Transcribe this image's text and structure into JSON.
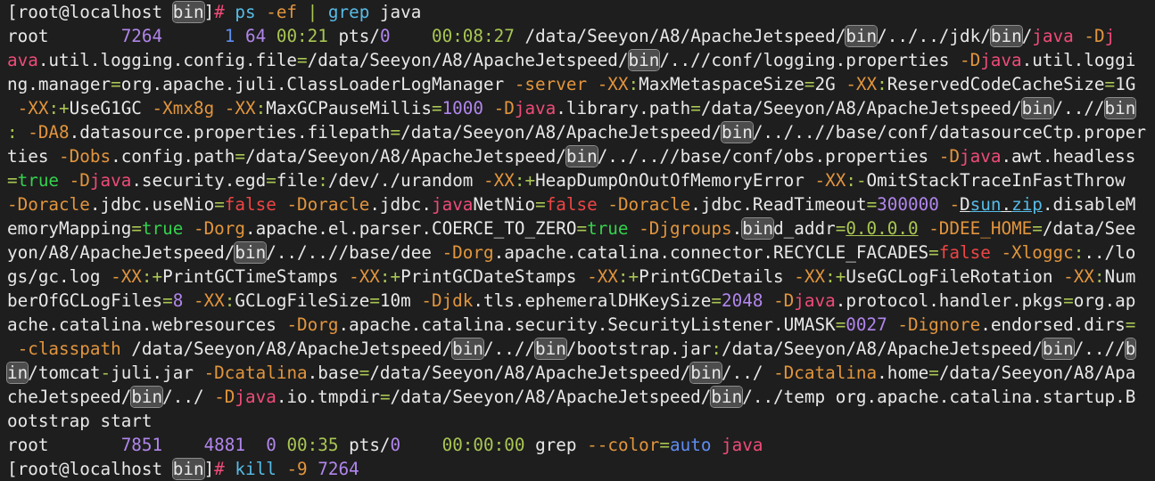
{
  "terminal": {
    "title": "root shell in /data/Seeyon/A8/ApacheJetspeed/bin",
    "search_highlight_term": "bin",
    "grep_match_term": "java",
    "palette": {
      "bg": "#1e1e1e",
      "fg": "#e8e8e8",
      "pink": "#ee4b78",
      "orange": "#e2953d",
      "green": "#a9c653",
      "bgreen": "#35d14e",
      "red": "#ef4545",
      "purple": "#b186ec",
      "blue": "#5f8df2",
      "cyan": "#57bbe6",
      "hlbg": "#4d4d4d",
      "hlborder": "#8d8d8d"
    },
    "prompt": {
      "user_host": "root@localhost",
      "cwd": "bin",
      "symbol": "#"
    },
    "commands": [
      "ps -ef | grep java",
      "kill -9 7264"
    ],
    "process_table": {
      "rows": [
        {
          "uid": "root",
          "pid": "7264",
          "ppid": "1",
          "c": "64",
          "stime": "00:21",
          "tty": "pts/0",
          "time": "00:08:27",
          "cmd_start": "/data/Seeyon/A8/ApacheJetspeed/bin/../../jdk/bin/java"
        },
        {
          "uid": "root",
          "pid": "7851",
          "ppid": "4881",
          "c": "0",
          "stime": "00:35",
          "tty": "pts/0",
          "time": "00:00:00",
          "cmd_start": "grep --color=auto java"
        }
      ]
    },
    "lines": [
      [
        {
          "t": "[root@localhost "
        },
        {
          "t": "bin",
          "h": true
        },
        {
          "t": "]"
        },
        {
          "t": "#",
          "c": "pink"
        },
        {
          "t": " "
        },
        {
          "t": "ps",
          "c": "cyan"
        },
        {
          "t": " "
        },
        {
          "t": "-ef",
          "c": "orange"
        },
        {
          "t": " "
        },
        {
          "t": "|",
          "c": "green"
        },
        {
          "t": " "
        },
        {
          "t": "grep",
          "c": "cyan"
        },
        {
          "t": " java"
        }
      ],
      [
        {
          "t": "root       "
        },
        {
          "t": "7264",
          "c": "purple"
        },
        {
          "t": "      "
        },
        {
          "t": "1",
          "c": "blue"
        },
        {
          "t": " "
        },
        {
          "t": "64",
          "c": "purple"
        },
        {
          "t": " "
        },
        {
          "t": "00:21",
          "c": "green"
        },
        {
          "t": " pts/"
        },
        {
          "t": "0",
          "c": "purple"
        },
        {
          "t": "    "
        },
        {
          "t": "00:08:27",
          "c": "green"
        },
        {
          "t": " /data/Seeyon/A8/ApacheJetspeed/"
        },
        {
          "t": "bin",
          "h": true
        },
        {
          "t": "/../../jdk/"
        },
        {
          "t": "bin",
          "h": true
        },
        {
          "t": "/"
        },
        {
          "t": "java",
          "c": "pink"
        },
        {
          "t": " "
        },
        {
          "t": "-D",
          "c": "orange"
        },
        {
          "t": "j",
          "c": "pink"
        }
      ],
      [
        {
          "t": "ava",
          "c": "pink"
        },
        {
          "t": ".util.logging.config.file"
        },
        {
          "t": "=",
          "c": "green"
        },
        {
          "t": "/data/Seeyon/A8/ApacheJetspeed/"
        },
        {
          "t": "bin",
          "h": true
        },
        {
          "t": "/..//conf/logging.properties "
        },
        {
          "t": "-D",
          "c": "orange"
        },
        {
          "t": "java",
          "c": "pink"
        },
        {
          "t": ".util.loggi"
        }
      ],
      [
        {
          "t": "ng.manager"
        },
        {
          "t": "=",
          "c": "green"
        },
        {
          "t": "org.apache.juli.ClassLoaderLogManager "
        },
        {
          "t": "-server",
          "c": "orange"
        },
        {
          "t": " "
        },
        {
          "t": "-XX",
          "c": "orange"
        },
        {
          "t": ":",
          "c": "green"
        },
        {
          "t": "MaxMetaspaceSize"
        },
        {
          "t": "=",
          "c": "green"
        },
        {
          "t": "2G "
        },
        {
          "t": "-XX",
          "c": "orange"
        },
        {
          "t": ":",
          "c": "green"
        },
        {
          "t": "ReservedCodeCacheSize"
        },
        {
          "t": "=",
          "c": "green"
        },
        {
          "t": "1G"
        }
      ],
      [
        {
          "t": " "
        },
        {
          "t": "-XX",
          "c": "orange"
        },
        {
          "t": ":",
          "c": "green"
        },
        {
          "t": "+",
          "c": "green"
        },
        {
          "t": "UseG1GC "
        },
        {
          "t": "-Xmx8g",
          "c": "orange"
        },
        {
          "t": " "
        },
        {
          "t": "-XX",
          "c": "orange"
        },
        {
          "t": ":",
          "c": "green"
        },
        {
          "t": "MaxGCPauseMillis"
        },
        {
          "t": "=",
          "c": "green"
        },
        {
          "t": "1000",
          "c": "purple"
        },
        {
          "t": " "
        },
        {
          "t": "-D",
          "c": "orange"
        },
        {
          "t": "java",
          "c": "pink"
        },
        {
          "t": ".library.path"
        },
        {
          "t": "=",
          "c": "green"
        },
        {
          "t": "/data/Seeyon/A8/ApacheJetspeed/"
        },
        {
          "t": "bin",
          "h": true
        },
        {
          "t": "/..//"
        },
        {
          "t": "bin",
          "h": true
        }
      ],
      [
        {
          "t": ":",
          "c": "green"
        },
        {
          "t": " "
        },
        {
          "t": "-DA8",
          "c": "orange"
        },
        {
          "t": ".datasource.properties.filepath"
        },
        {
          "t": "=",
          "c": "green"
        },
        {
          "t": "/data/Seeyon/A8/ApacheJetspeed/"
        },
        {
          "t": "bin",
          "h": true
        },
        {
          "t": "/../..//base/conf/datasourceCtp.proper"
        }
      ],
      [
        {
          "t": "ties "
        },
        {
          "t": "-Dobs",
          "c": "orange"
        },
        {
          "t": ".config.path"
        },
        {
          "t": "=",
          "c": "green"
        },
        {
          "t": "/data/Seeyon/A8/ApacheJetspeed/"
        },
        {
          "t": "bin",
          "h": true
        },
        {
          "t": "/../..//base/conf/obs.properties "
        },
        {
          "t": "-D",
          "c": "orange"
        },
        {
          "t": "java",
          "c": "pink"
        },
        {
          "t": ".awt.headless"
        }
      ],
      [
        {
          "t": "=",
          "c": "green"
        },
        {
          "t": "true",
          "c": "bgreen"
        },
        {
          "t": " "
        },
        {
          "t": "-D",
          "c": "orange"
        },
        {
          "t": "java",
          "c": "pink"
        },
        {
          "t": ".security.egd"
        },
        {
          "t": "=",
          "c": "green"
        },
        {
          "t": "file"
        },
        {
          "t": ":",
          "c": "green"
        },
        {
          "t": "/dev/./urandom "
        },
        {
          "t": "-XX",
          "c": "orange"
        },
        {
          "t": ":",
          "c": "green"
        },
        {
          "t": "+",
          "c": "green"
        },
        {
          "t": "HeapDumpOnOutOfMemoryError "
        },
        {
          "t": "-XX",
          "c": "orange"
        },
        {
          "t": ":",
          "c": "green"
        },
        {
          "t": "-",
          "c": "green"
        },
        {
          "t": "OmitStackTraceInFastThrow"
        }
      ],
      [
        {
          "t": "-Doracle",
          "c": "orange"
        },
        {
          "t": ".jdbc.useNio"
        },
        {
          "t": "=",
          "c": "green"
        },
        {
          "t": "false",
          "c": "red"
        },
        {
          "t": " "
        },
        {
          "t": "-Doracle",
          "c": "orange"
        },
        {
          "t": ".jdbc."
        },
        {
          "t": "java",
          "c": "pink"
        },
        {
          "t": "NetNio"
        },
        {
          "t": "=",
          "c": "green"
        },
        {
          "t": "false",
          "c": "red"
        },
        {
          "t": " "
        },
        {
          "t": "-Doracle",
          "c": "orange"
        },
        {
          "t": ".jdbc.ReadTimeout"
        },
        {
          "t": "=",
          "c": "green"
        },
        {
          "t": "300000",
          "c": "purple"
        },
        {
          "t": " "
        },
        {
          "t": "-",
          "c": "orange"
        },
        {
          "t": "D",
          "u": true
        },
        {
          "t": "sun",
          "c": "cyan",
          "u": true
        },
        {
          "t": ".",
          "u": true
        },
        {
          "t": "zip",
          "c": "cyan",
          "u": true
        },
        {
          "t": ".disableM"
        }
      ],
      [
        {
          "t": "emoryMapping"
        },
        {
          "t": "=",
          "c": "green"
        },
        {
          "t": "true",
          "c": "bgreen"
        },
        {
          "t": " "
        },
        {
          "t": "-Dorg",
          "c": "orange"
        },
        {
          "t": ".apache.el.parser.COERCE_TO_ZERO"
        },
        {
          "t": "=",
          "c": "green"
        },
        {
          "t": "true",
          "c": "bgreen"
        },
        {
          "t": " "
        },
        {
          "t": "-Djgroups",
          "c": "orange"
        },
        {
          "t": "."
        },
        {
          "t": "bin",
          "h": true
        },
        {
          "t": "d_addr"
        },
        {
          "t": "=",
          "c": "green"
        },
        {
          "t": "0.0.0.0",
          "c": "green",
          "u": true
        },
        {
          "t": " "
        },
        {
          "t": "-DDEE_HOME",
          "c": "orange"
        },
        {
          "t": "=",
          "c": "green"
        },
        {
          "t": "/data/See"
        }
      ],
      [
        {
          "t": "yon/A8/ApacheJetspeed/"
        },
        {
          "t": "bin",
          "h": true
        },
        {
          "t": "/../..//base/dee "
        },
        {
          "t": "-Dorg",
          "c": "orange"
        },
        {
          "t": ".apache.catalina.connector.RECYCLE_FACADES"
        },
        {
          "t": "=",
          "c": "green"
        },
        {
          "t": "false",
          "c": "red"
        },
        {
          "t": " "
        },
        {
          "t": "-Xloggc",
          "c": "orange"
        },
        {
          "t": ":",
          "c": "green"
        },
        {
          "t": "../lo"
        }
      ],
      [
        {
          "t": "gs/gc.log "
        },
        {
          "t": "-XX",
          "c": "orange"
        },
        {
          "t": ":",
          "c": "green"
        },
        {
          "t": "+",
          "c": "green"
        },
        {
          "t": "PrintGCTimeStamps "
        },
        {
          "t": "-XX",
          "c": "orange"
        },
        {
          "t": ":",
          "c": "green"
        },
        {
          "t": "+",
          "c": "green"
        },
        {
          "t": "PrintGCDateStamps "
        },
        {
          "t": "-XX",
          "c": "orange"
        },
        {
          "t": ":",
          "c": "green"
        },
        {
          "t": "+",
          "c": "green"
        },
        {
          "t": "PrintGCDetails "
        },
        {
          "t": "-XX",
          "c": "orange"
        },
        {
          "t": ":",
          "c": "green"
        },
        {
          "t": "+",
          "c": "green"
        },
        {
          "t": "UseGCLogFileRotation "
        },
        {
          "t": "-XX",
          "c": "orange"
        },
        {
          "t": ":",
          "c": "green"
        },
        {
          "t": "Num"
        }
      ],
      [
        {
          "t": "berOfGCLogFiles"
        },
        {
          "t": "=",
          "c": "green"
        },
        {
          "t": "8",
          "c": "purple"
        },
        {
          "t": " "
        },
        {
          "t": "-XX",
          "c": "orange"
        },
        {
          "t": ":",
          "c": "green"
        },
        {
          "t": "GCLogFileSize"
        },
        {
          "t": "=",
          "c": "green"
        },
        {
          "t": "10m "
        },
        {
          "t": "-Djdk",
          "c": "orange"
        },
        {
          "t": ".tls.ephemeralDHKeySize"
        },
        {
          "t": "=",
          "c": "green"
        },
        {
          "t": "2048",
          "c": "purple"
        },
        {
          "t": " "
        },
        {
          "t": "-D",
          "c": "orange"
        },
        {
          "t": "java",
          "c": "pink"
        },
        {
          "t": ".protocol.handler.pkgs"
        },
        {
          "t": "=",
          "c": "green"
        },
        {
          "t": "org.ap"
        }
      ],
      [
        {
          "t": "ache.catalina.webresources "
        },
        {
          "t": "-Dorg",
          "c": "orange"
        },
        {
          "t": ".apache.catalina.security.SecurityListener.UMASK"
        },
        {
          "t": "=",
          "c": "green"
        },
        {
          "t": "0027",
          "c": "purple"
        },
        {
          "t": " "
        },
        {
          "t": "-Dignore",
          "c": "orange"
        },
        {
          "t": ".endorsed.dirs"
        },
        {
          "t": "=",
          "c": "green"
        }
      ],
      [
        {
          "t": " "
        },
        {
          "t": "-classpath",
          "c": "orange"
        },
        {
          "t": " /data/Seeyon/A8/ApacheJetspeed/"
        },
        {
          "t": "bin",
          "h": true
        },
        {
          "t": "/..//"
        },
        {
          "t": "bin",
          "h": true
        },
        {
          "t": "/bootstrap.jar"
        },
        {
          "t": ":",
          "c": "green"
        },
        {
          "t": "/data/Seeyon/A8/ApacheJetspeed/"
        },
        {
          "t": "bin",
          "h": true
        },
        {
          "t": "/..//"
        },
        {
          "t": "b",
          "h": true
        }
      ],
      [
        {
          "t": "in",
          "h": true
        },
        {
          "t": "/tomcat"
        },
        {
          "t": "-",
          "c": "green"
        },
        {
          "t": "juli.jar "
        },
        {
          "t": "-Dcatalina",
          "c": "orange"
        },
        {
          "t": ".base"
        },
        {
          "t": "=",
          "c": "green"
        },
        {
          "t": "/data/Seeyon/A8/ApacheJetspeed/"
        },
        {
          "t": "bin",
          "h": true
        },
        {
          "t": "/../ "
        },
        {
          "t": "-Dcatalina",
          "c": "orange"
        },
        {
          "t": ".home"
        },
        {
          "t": "=",
          "c": "green"
        },
        {
          "t": "/data/Seeyon/A8/Apa"
        }
      ],
      [
        {
          "t": "cheJetspeed/"
        },
        {
          "t": "bin",
          "h": true
        },
        {
          "t": "/../ "
        },
        {
          "t": "-D",
          "c": "orange"
        },
        {
          "t": "java",
          "c": "pink"
        },
        {
          "t": ".io.tmpdir"
        },
        {
          "t": "=",
          "c": "green"
        },
        {
          "t": "/data/Seeyon/A8/ApacheJetspeed/"
        },
        {
          "t": "bin",
          "h": true
        },
        {
          "t": "/../temp org.apache.catalina.startup.B"
        }
      ],
      [
        {
          "t": "ootstrap start"
        }
      ],
      [
        {
          "t": "root       "
        },
        {
          "t": "7851",
          "c": "purple"
        },
        {
          "t": "    "
        },
        {
          "t": "4881",
          "c": "purple"
        },
        {
          "t": "  "
        },
        {
          "t": "0",
          "c": "purple"
        },
        {
          "t": " "
        },
        {
          "t": "00:35",
          "c": "green"
        },
        {
          "t": " pts/"
        },
        {
          "t": "0",
          "c": "purple"
        },
        {
          "t": "    "
        },
        {
          "t": "00:00:00",
          "c": "green"
        },
        {
          "t": " grep "
        },
        {
          "t": "--color",
          "c": "orange"
        },
        {
          "t": "=",
          "c": "green"
        },
        {
          "t": "auto",
          "c": "blue"
        },
        {
          "t": " "
        },
        {
          "t": "java",
          "c": "pink"
        }
      ],
      [
        {
          "t": "[root@localhost "
        },
        {
          "t": "bin",
          "h": true
        },
        {
          "t": "]"
        },
        {
          "t": "#",
          "c": "pink"
        },
        {
          "t": " "
        },
        {
          "t": "kill",
          "c": "cyan"
        },
        {
          "t": " "
        },
        {
          "t": "-9",
          "c": "orange"
        },
        {
          "t": " "
        },
        {
          "t": "7264",
          "c": "purple"
        }
      ]
    ]
  }
}
